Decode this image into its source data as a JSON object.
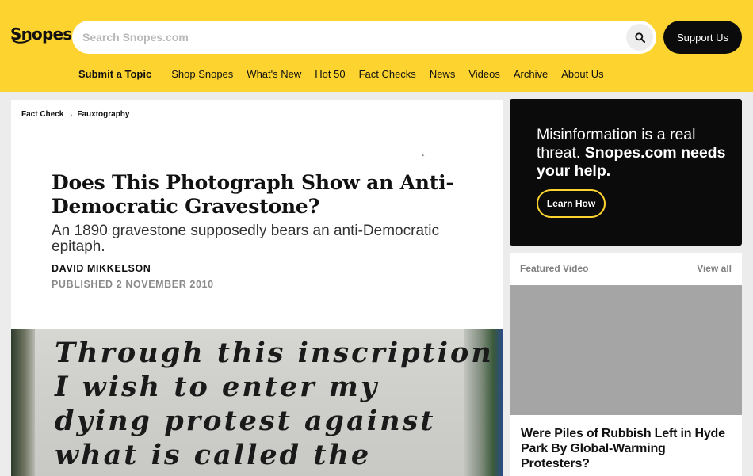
{
  "header": {
    "logo_text": "Snopes",
    "search_placeholder": "Search Snopes.com",
    "search_icon": "search-icon",
    "support_label": "Support Us",
    "brand_color": "#fdd42f"
  },
  "nav": {
    "submit_label": "Submit a Topic",
    "items": [
      "Shop Snopes",
      "What's New",
      "Hot 50",
      "Fact Checks",
      "News",
      "Videos",
      "Archive",
      "About Us"
    ]
  },
  "article": {
    "breadcrumb": [
      "Fact Check",
      "Fauxtography"
    ],
    "title": "Does This Photograph Show an Anti-Democratic Gravestone?",
    "subtitle": "An 1890 gravestone supposedly bears an anti-Democratic epitaph.",
    "author": "DAVID MIKKELSON",
    "published": "PUBLISHED 2 NOVEMBER 2010",
    "image_lines": [
      "Through this inscription",
      "I wish to enter my",
      "dying protest against",
      "what is called the"
    ]
  },
  "promo": {
    "text_plain": "Misinformation is a real threat. ",
    "text_bold": "Snopes.com needs your help.",
    "button_label": "Learn How"
  },
  "featured": {
    "label": "Featured Video",
    "view_all": "View all",
    "video_title": "Were Piles of Rubbish Left in Hyde Park By Global-Warming Protesters?"
  }
}
